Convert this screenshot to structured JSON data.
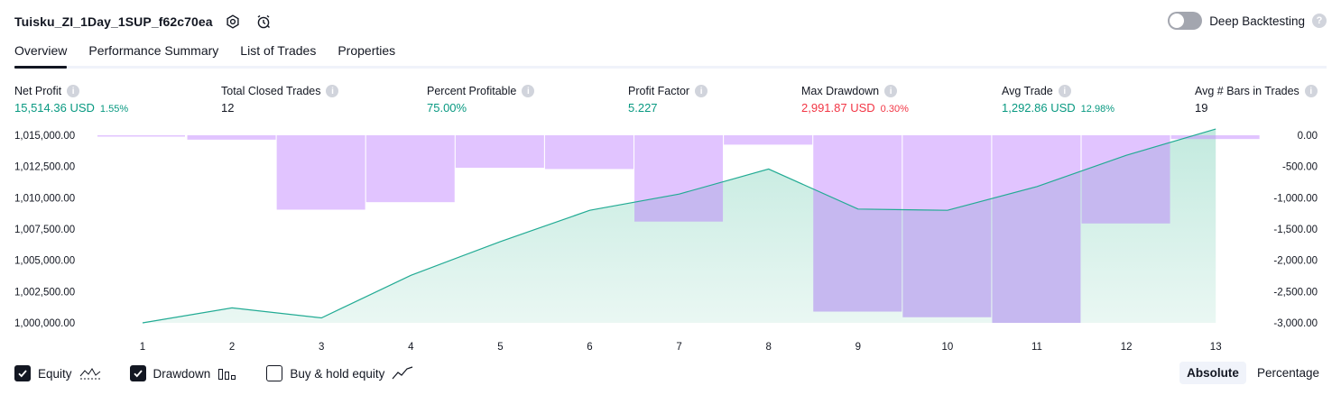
{
  "header": {
    "strategy_name": "Tuisku_ZI_1Day_1SUP_f62c70ea",
    "deep_backtesting_label": "Deep Backtesting",
    "deep_backtesting_on": false
  },
  "tabs": [
    {
      "label": "Overview",
      "active": true
    },
    {
      "label": "Performance Summary",
      "active": false
    },
    {
      "label": "List of Trades",
      "active": false
    },
    {
      "label": "Properties",
      "active": false
    }
  ],
  "metrics": [
    {
      "label": "Net Profit",
      "value": "15,514.36 USD",
      "pct": "1.55%",
      "color": "green"
    },
    {
      "label": "Total Closed Trades",
      "value": "12",
      "pct": "",
      "color": "dark"
    },
    {
      "label": "Percent Profitable",
      "value": "75.00%",
      "pct": "",
      "color": "green"
    },
    {
      "label": "Profit Factor",
      "value": "5.227",
      "pct": "",
      "color": "green"
    },
    {
      "label": "Max Drawdown",
      "value": "2,991.87 USD",
      "pct": "0.30%",
      "color": "red"
    },
    {
      "label": "Avg Trade",
      "value": "1,292.86 USD",
      "pct": "12.98%",
      "color": "green"
    },
    {
      "label": "Avg # Bars in Trades",
      "value": "19",
      "pct": "",
      "color": "dark"
    }
  ],
  "chart_data": {
    "type": "area",
    "x": [
      1,
      2,
      3,
      4,
      5,
      6,
      7,
      8,
      9,
      10,
      11,
      12,
      13
    ],
    "left_axis_ticks": [
      "1,015,000.00",
      "1,012,500.00",
      "1,010,000.00",
      "1,007,500.00",
      "1,005,000.00",
      "1,002,500.00",
      "1,000,000.00"
    ],
    "right_axis_ticks": [
      "0.00",
      "-500.00",
      "-1,000.00",
      "-1,500.00",
      "-2,000.00",
      "-2,500.00",
      "-3,000.00"
    ],
    "equity_ylim": [
      1000000,
      1015000
    ],
    "drawdown_ylim": [
      -3000,
      0
    ],
    "series": [
      {
        "name": "Equity",
        "axis": "left",
        "values": [
          1000000,
          1001200,
          1000400,
          1003800,
          1006500,
          1009000,
          1010300,
          1012300,
          1009100,
          1009000,
          1010900,
          1013400,
          1015500
        ]
      },
      {
        "name": "Drawdown",
        "axis": "right",
        "values": [
          -10,
          -70,
          -1190,
          -1070,
          -520,
          -540,
          -1380,
          -150,
          -2820,
          -2910,
          -3000,
          -1410,
          -60
        ]
      }
    ],
    "colors": {
      "equity_line": "#22ab94",
      "equity_fill_top": "#b8e6d9",
      "equity_fill_bottom": "#e6f6f1",
      "drawdown_bar": "#e1c4ff",
      "drawdown_overlap": "#c6b8f0"
    },
    "grid": false
  },
  "legend": [
    {
      "label": "Equity",
      "checked": true,
      "icon": "equity-wave-icon"
    },
    {
      "label": "Drawdown",
      "checked": true,
      "icon": "drawdown-bars-icon"
    },
    {
      "label": "Buy & hold equity",
      "checked": false,
      "icon": "buy-hold-line-icon"
    }
  ],
  "mode": {
    "absolute_label": "Absolute",
    "percentage_label": "Percentage",
    "selected": "Absolute"
  }
}
